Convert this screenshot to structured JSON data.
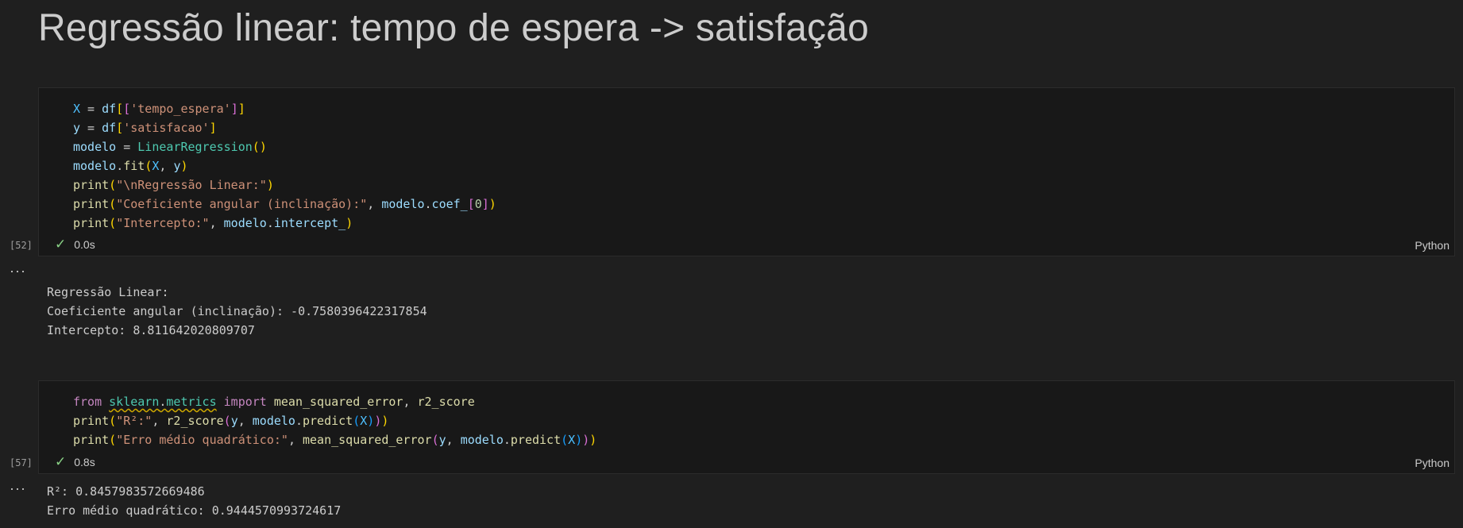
{
  "heading": "Regressão linear: tempo de espera -> satisfação",
  "cells": [
    {
      "exec_count": "[52]",
      "duration": "0.0s",
      "language": "Python",
      "code": {
        "l1": {
          "a": "X",
          "b": " = ",
          "c": "df",
          "d": "[",
          "e": "[",
          "f": "'tempo_espera'",
          "g": "]",
          "h": "]"
        },
        "l2": {
          "a": "y",
          "b": " = ",
          "c": "df",
          "d": "[",
          "e": "'satisfacao'",
          "f": "]"
        },
        "l3": {
          "a": "modelo",
          "b": " = ",
          "c": "LinearRegression",
          "d": "(",
          "e": ")"
        },
        "l4": {
          "a": "modelo",
          "b": ".",
          "c": "fit",
          "d": "(",
          "e": "X",
          "f": ", ",
          "g": "y",
          "h": ")"
        },
        "l5": {
          "a": "print",
          "b": "(",
          "c": "\"\\nRegressão Linear:\"",
          "d": ")"
        },
        "l6": {
          "a": "print",
          "b": "(",
          "c": "\"Coeficiente angular (inclinação):\"",
          "d": ", ",
          "e": "modelo",
          "f": ".",
          "g": "coef_",
          "h": "[",
          "i": "0",
          "j": "]",
          "k": ")"
        },
        "l7": {
          "a": "print",
          "b": "(",
          "c": "\"Intercepto:\"",
          "d": ", ",
          "e": "modelo",
          "f": ".",
          "g": "intercept_",
          "h": ")"
        }
      },
      "output": {
        "line1": "Regressão Linear:",
        "line2": "Coeficiente angular (inclinação): -0.7580396422317854",
        "line3": "Intercepto: 8.811642020809707"
      }
    },
    {
      "exec_count": "[57]",
      "duration": "0.8s",
      "language": "Python",
      "code": {
        "l1": {
          "a": "from",
          "b": " ",
          "c": "sklearn",
          "d": ".",
          "e": "metrics",
          "f": " ",
          "g": "import",
          "h": " ",
          "i": "mean_squared_error",
          "j": ", ",
          "k": "r2_score"
        },
        "l2": {
          "a": "print",
          "b": "(",
          "c": "\"R²:\"",
          "d": ", ",
          "e": "r2_score",
          "f": "(",
          "g": "y",
          "h": ", ",
          "i": "modelo",
          "j": ".",
          "k": "predict",
          "l": "(",
          "m": "X",
          "n": ")",
          "o": ")",
          "p": ")"
        },
        "l3": {
          "a": "print",
          "b": "(",
          "c": "\"Erro médio quadrático:\"",
          "d": ", ",
          "e": "mean_squared_error",
          "f": "(",
          "g": "y",
          "h": ", ",
          "i": "modelo",
          "j": ".",
          "k": "predict",
          "l": "(",
          "m": "X",
          "n": ")",
          "o": ")",
          "p": ")"
        }
      },
      "output": {
        "line1": "R²: 0.8457983572669486",
        "line2": "Erro médio quadrático: 0.9444570993724617"
      }
    }
  ],
  "ui": {
    "more_glyph": "···",
    "check_glyph": "✓"
  }
}
